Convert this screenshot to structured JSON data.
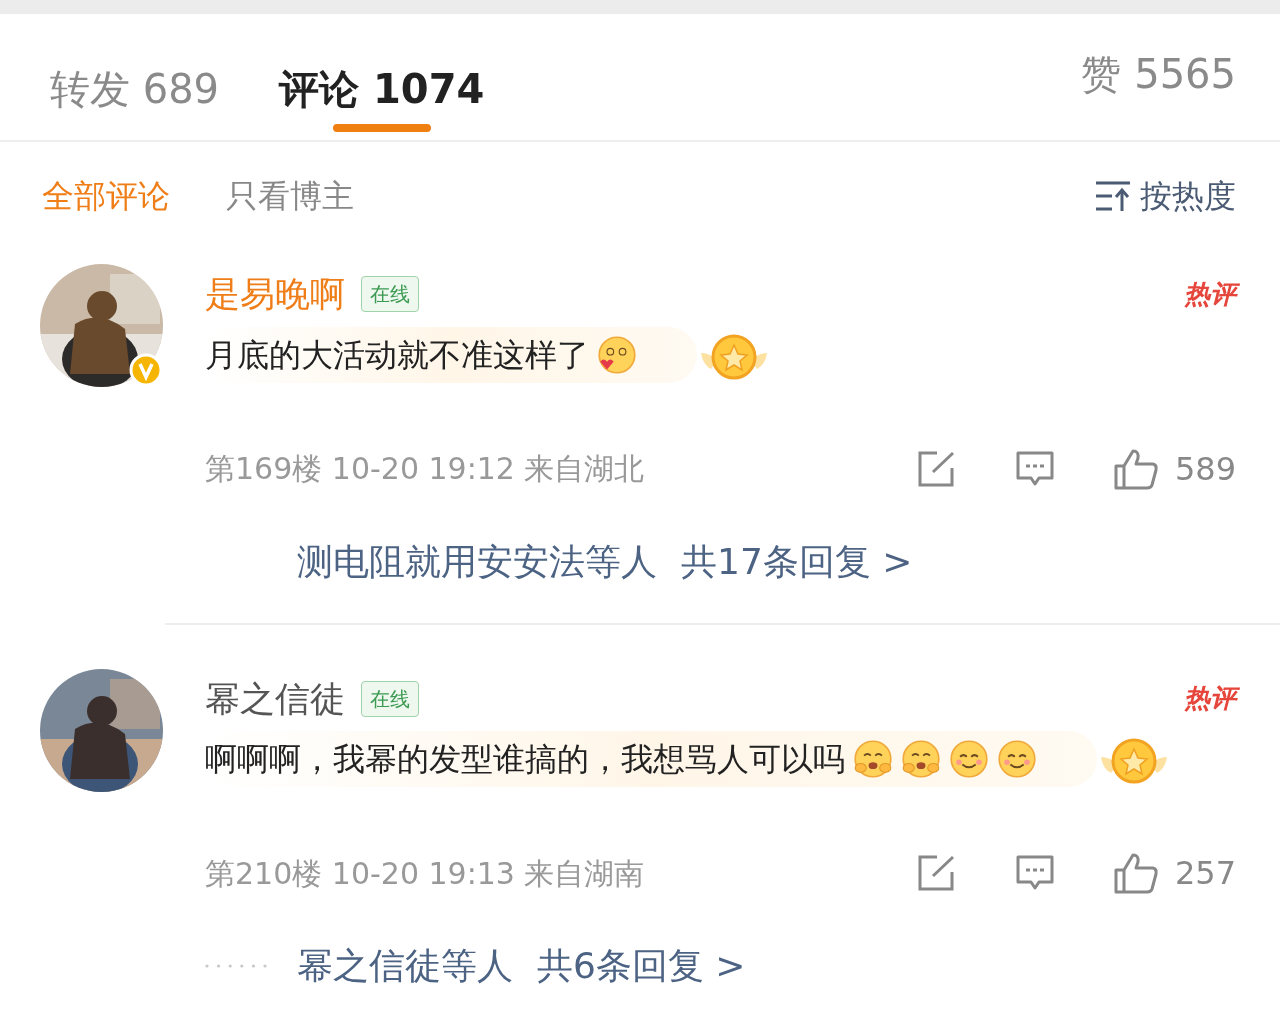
{
  "tabs": [
    {
      "label": "转发",
      "count": "689",
      "selected": false
    },
    {
      "label": "评论",
      "count": "1074",
      "selected": true
    }
  ],
  "likes": {
    "label": "赞",
    "count": "5565"
  },
  "filters": [
    {
      "label": "全部评论",
      "selected": true
    },
    {
      "label": "只看博主",
      "selected": false
    }
  ],
  "sort": {
    "label": "按热度"
  },
  "comments": [
    {
      "user": "是易晚啊",
      "vip": true,
      "verified": true,
      "online_badge": "在线",
      "hot_badge": "热评",
      "text": "月底的大活动就不准这样了",
      "emojis": [
        {
          "kind": "heart"
        }
      ],
      "floor": "第169楼",
      "time": "10-20 19:12",
      "location": "来自湖北",
      "likes": "589",
      "replies": {
        "names": "测电阻就用安安法等人",
        "count": "共17条回复 >"
      }
    },
    {
      "user": "幂之信徒",
      "vip": false,
      "verified": false,
      "online_badge": "在线",
      "hot_badge": "热评",
      "text": "啊啊啊，我幂的发型谁搞的，我想骂人可以吗",
      "emojis": [
        {
          "kind": "hug"
        },
        {
          "kind": "hug"
        },
        {
          "kind": "smile"
        },
        {
          "kind": "smile"
        }
      ],
      "floor": "第210楼",
      "time": "10-20 19:13",
      "location": "来自湖南",
      "likes": "257",
      "replies": {
        "names": "幂之信徒等人",
        "count": "共6条回复 >"
      }
    }
  ]
}
